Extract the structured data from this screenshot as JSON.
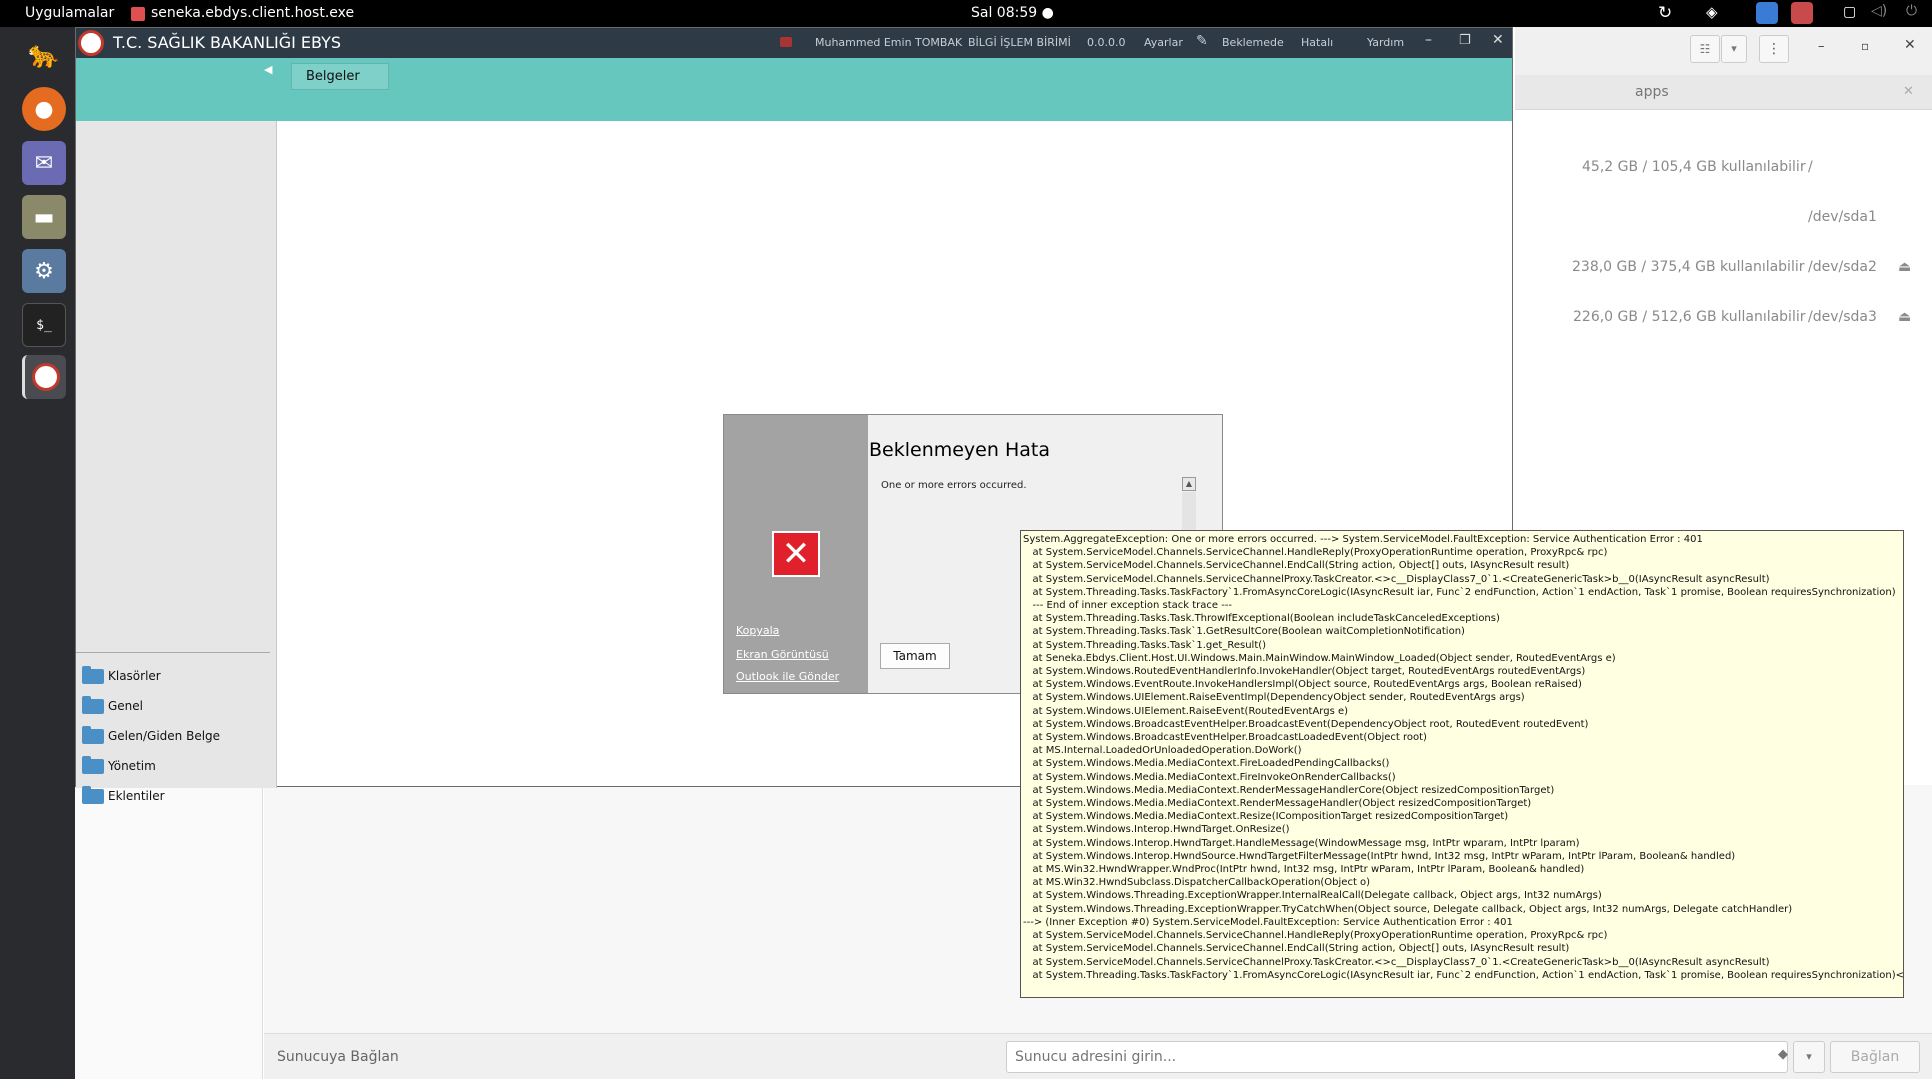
{
  "topbar": {
    "apps_label": "Uygulamalar",
    "window_title": "seneka.ebdys.client.host.exe",
    "clock": "Sal 08:59 ●"
  },
  "files": {
    "tab_title": "apps",
    "rows": [
      {
        "usage": "45,2 GB / 105,4 GB kullanılabilir",
        "device": "/"
      },
      {
        "usage": "",
        "device": "/dev/sda1"
      },
      {
        "usage": "238,0 GB / 375,4 GB kullanılabilir",
        "device": "/dev/sda2"
      },
      {
        "usage": "226,0 GB / 512,6 GB kullanılabilir",
        "device": "/dev/sda3"
      }
    ],
    "connect_label": "Sunucuya Bağlan",
    "server_placeholder": "Sunucu adresini girin...",
    "connect_button": "Bağlan"
  },
  "ebys": {
    "title": "T.C. SAĞLIK BAKANLIĞI EBYS",
    "user": "Muhammed Emin TOMBAK",
    "unit": "BİLGİ İŞLEM BİRİMİ",
    "version": "0.0.0.0",
    "settings": "Ayarlar",
    "pending": "Beklemede",
    "errors": "Hatalı",
    "help": "Yardım",
    "tab_documents": "Belgeler",
    "folders": [
      "Klasörler",
      "Genel",
      "Gelen/Giden Belge",
      "Yönetim",
      "Eklentiler"
    ]
  },
  "dialog": {
    "title": "Beklenmeyen Hata",
    "message": "One or more errors occurred.",
    "copy_link": "Kopyala",
    "screenshot_link": "Ekran Görüntüsü",
    "outlook_link": "Outlook ile Gönder",
    "ok_button": "Tamam"
  },
  "error_detail": "System.AggregateException: One or more errors occurred. ---> System.ServiceModel.FaultException: Service Authentication Error : 401\n   at System.ServiceModel.Channels.ServiceChannel.HandleReply(ProxyOperationRuntime operation, ProxyRpc& rpc)\n   at System.ServiceModel.Channels.ServiceChannel.EndCall(String action, Object[] outs, IAsyncResult result)\n   at System.ServiceModel.Channels.ServiceChannelProxy.TaskCreator.<>c__DisplayClass7_0`1.<CreateGenericTask>b__0(IAsyncResult asyncResult)\n   at System.Threading.Tasks.TaskFactory`1.FromAsyncCoreLogic(IAsyncResult iar, Func`2 endFunction, Action`1 endAction, Task`1 promise, Boolean requiresSynchronization)\n   --- End of inner exception stack trace ---\n   at System.Threading.Tasks.Task.ThrowIfExceptional(Boolean includeTaskCanceledExceptions)\n   at System.Threading.Tasks.Task`1.GetResultCore(Boolean waitCompletionNotification)\n   at System.Threading.Tasks.Task`1.get_Result()\n   at Seneka.Ebdys.Client.Host.UI.Windows.Main.MainWindow.MainWindow_Loaded(Object sender, RoutedEventArgs e)\n   at System.Windows.RoutedEventHandlerInfo.InvokeHandler(Object target, RoutedEventArgs routedEventArgs)\n   at System.Windows.EventRoute.InvokeHandlersImpl(Object source, RoutedEventArgs args, Boolean reRaised)\n   at System.Windows.UIElement.RaiseEventImpl(DependencyObject sender, RoutedEventArgs args)\n   at System.Windows.UIElement.RaiseEvent(RoutedEventArgs e)\n   at System.Windows.BroadcastEventHelper.BroadcastEvent(DependencyObject root, RoutedEvent routedEvent)\n   at System.Windows.BroadcastEventHelper.BroadcastLoadedEvent(Object root)\n   at MS.Internal.LoadedOrUnloadedOperation.DoWork()\n   at System.Windows.Media.MediaContext.FireLoadedPendingCallbacks()\n   at System.Windows.Media.MediaContext.FireInvokeOnRenderCallbacks()\n   at System.Windows.Media.MediaContext.RenderMessageHandlerCore(Object resizedCompositionTarget)\n   at System.Windows.Media.MediaContext.RenderMessageHandler(Object resizedCompositionTarget)\n   at System.Windows.Media.MediaContext.Resize(ICompositionTarget resizedCompositionTarget)\n   at System.Windows.Interop.HwndTarget.OnResize()\n   at System.Windows.Interop.HwndTarget.HandleMessage(WindowMessage msg, IntPtr wparam, IntPtr lparam)\n   at System.Windows.Interop.HwndSource.HwndTargetFilterMessage(IntPtr hwnd, Int32 msg, IntPtr wParam, IntPtr lParam, Boolean& handled)\n   at MS.Win32.HwndWrapper.WndProc(IntPtr hwnd, Int32 msg, IntPtr wParam, IntPtr lParam, Boolean& handled)\n   at MS.Win32.HwndSubclass.DispatcherCallbackOperation(Object o)\n   at System.Windows.Threading.ExceptionWrapper.InternalRealCall(Delegate callback, Object args, Int32 numArgs)\n   at System.Windows.Threading.ExceptionWrapper.TryCatchWhen(Object source, Delegate callback, Object args, Int32 numArgs, Delegate catchHandler)\n---> (Inner Exception #0) System.ServiceModel.FaultException: Service Authentication Error : 401\n   at System.ServiceModel.Channels.ServiceChannel.HandleReply(ProxyOperationRuntime operation, ProxyRpc& rpc)\n   at System.ServiceModel.Channels.ServiceChannel.EndCall(String action, Object[] outs, IAsyncResult result)\n   at System.ServiceModel.Channels.ServiceChannelProxy.TaskCreator.<>c__DisplayClass7_0`1.<CreateGenericTask>b__0(IAsyncResult asyncResult)\n   at System.Threading.Tasks.TaskFactory`1.FromAsyncCoreLogic(IAsyncResult iar, Func`2 endFunction, Action`1 endAction, Task`1 promise, Boolean requiresSynchronization)<---"
}
